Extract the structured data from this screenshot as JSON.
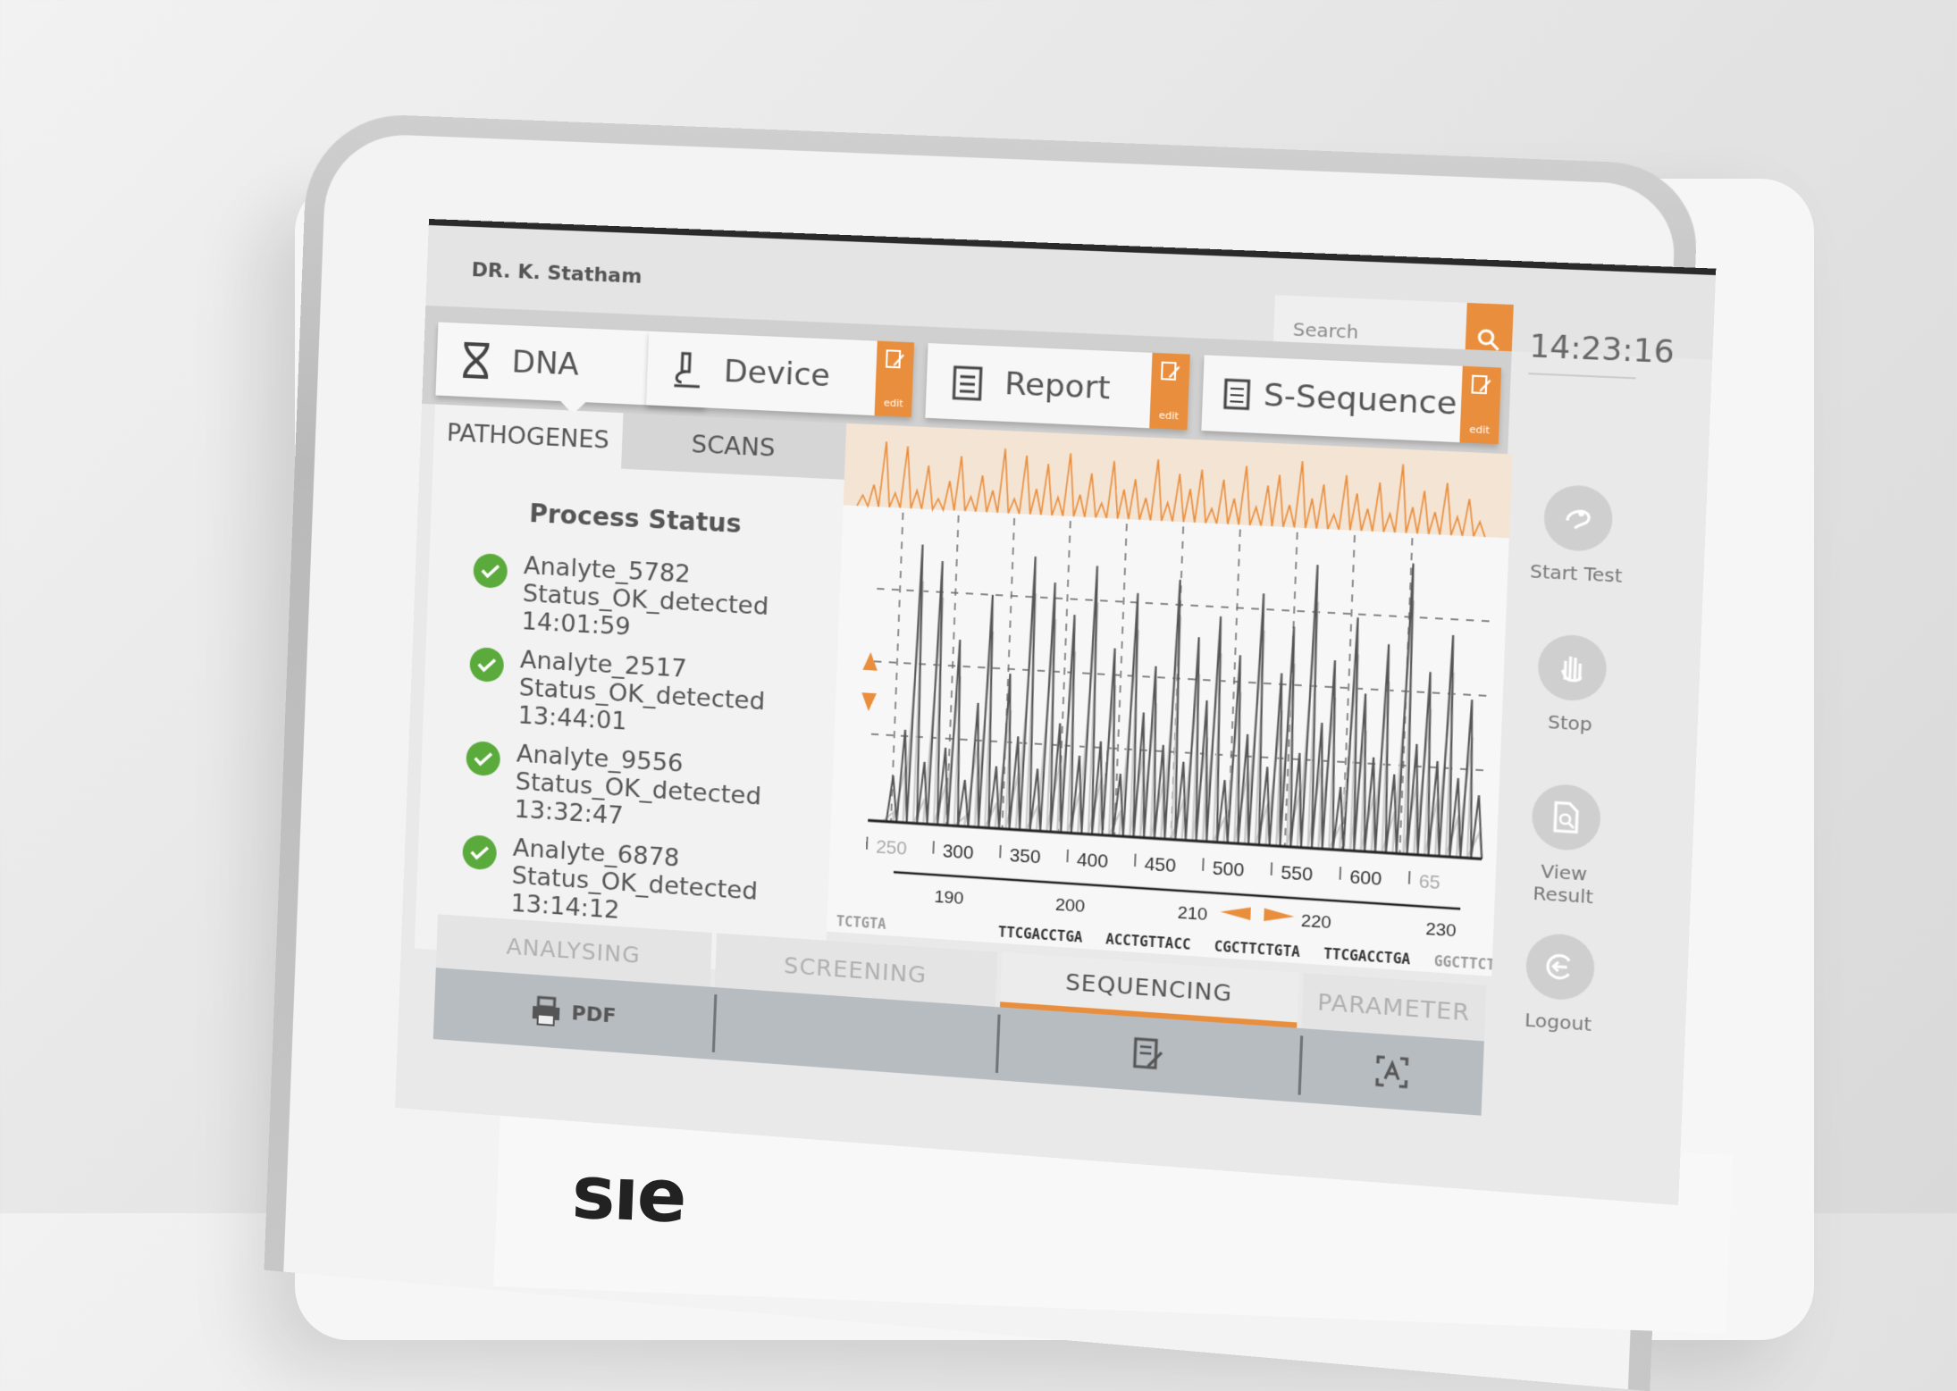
{
  "header": {
    "user_name": "DR. K. Statham",
    "search_placeholder": "Search",
    "time": "14:23:16"
  },
  "modules": [
    {
      "label": "DNA",
      "icon": "dna-icon",
      "edit_label": "edit"
    },
    {
      "label": "Device",
      "icon": "microscope-icon",
      "edit_label": "edit"
    },
    {
      "label": "Report",
      "icon": "clipboard-icon",
      "edit_label": "edit"
    },
    {
      "label": "S-Sequence",
      "icon": "list-document-icon",
      "edit_label": "edit"
    }
  ],
  "subtabs": {
    "pathogenes": "PATHOGENES",
    "scans": "SCANS"
  },
  "process_status": {
    "title": "Process Status",
    "items": [
      {
        "name": "Analyte_5782",
        "status": "Status_OK_detected",
        "time": "14:01:59"
      },
      {
        "name": "Analyte_2517",
        "status": "Status_OK_detected",
        "time": "13:44:01"
      },
      {
        "name": "Analyte_9556",
        "status": "Status_OK_detected",
        "time": "13:32:47"
      },
      {
        "name": "Analyte_6878",
        "status": "Status_OK_detected",
        "time": "13:14:12"
      }
    ]
  },
  "chart_data": {
    "type": "line",
    "x_ticks": [
      "250",
      "300",
      "350",
      "400",
      "450",
      "500",
      "550",
      "600",
      "65"
    ],
    "position_ticks": [
      "190",
      "200",
      "210",
      "220",
      "230"
    ],
    "sequence_rows": [
      [
        "TCTGTA",
        "TTCGACCTGA",
        "ACCTGTTACC",
        "CGCTTCTGTA",
        "TTCGACCTGA",
        "GGCTTCTGTA"
      ],
      [
        "TCTGTA",
        "TTCGACCTGA",
        "ACCTGTTACC",
        "CGCTTCTGTA",
        "TTCGACCTGA",
        "GGCTTCTGTA"
      ]
    ],
    "grid": true,
    "peaks": [
      0.15,
      0.3,
      0.9,
      0.2,
      0.85,
      0.25,
      0.6,
      0.15,
      0.4,
      0.75,
      0.2,
      0.5,
      0.3,
      0.88,
      0.2,
      0.8,
      0.35,
      0.7,
      0.25,
      0.86,
      0.3,
      0.6,
      0.2,
      0.78,
      0.4,
      0.55,
      0.3,
      0.83,
      0.25,
      0.65,
      0.45,
      0.72,
      0.2,
      0.6,
      0.35,
      0.8,
      0.25,
      0.55,
      0.7,
      0.3,
      0.9,
      0.4,
      0.6,
      0.2,
      0.74,
      0.5,
      0.3,
      0.66,
      0.25,
      0.92,
      0.35,
      0.58,
      0.3,
      0.7,
      0.25,
      0.5,
      0.2
    ]
  },
  "actions": [
    {
      "label": "Start  Test",
      "icon": "start-test-icon"
    },
    {
      "label": "Stop",
      "icon": "hand-icon"
    },
    {
      "label": "View Result",
      "icon": "search-document-icon"
    },
    {
      "label": "Logout",
      "icon": "logout-icon"
    }
  ],
  "bottom_tabs": [
    "ANALYSING",
    "SCREENING",
    "SEQUENCING",
    "PARAMETER"
  ],
  "toolbar": {
    "pdf_label": "PDF"
  },
  "brand": {
    "logo_text": "SIE"
  },
  "colors": {
    "accent": "#e98e3c",
    "check": "#5aaa3c",
    "text": "#555555"
  }
}
